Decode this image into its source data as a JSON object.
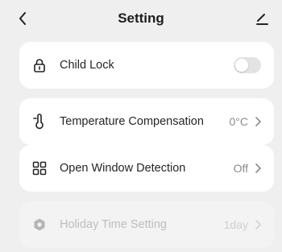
{
  "header": {
    "title": "Setting",
    "back_icon": "chevron-left-icon",
    "edit_icon": "edit-icon"
  },
  "settings": [
    {
      "label": "Child Lock",
      "icon": "lock-icon",
      "control": "toggle",
      "toggle_on": false
    },
    {
      "label": "Temperature Compensation",
      "icon": "thermometer-icon",
      "value": "0°C"
    },
    {
      "label": "Open Window Detection",
      "icon": "grid-icon",
      "value": "Off"
    },
    {
      "label": "Holiday Time Setting",
      "icon": "hexagon-icon",
      "value": "1day",
      "disabled": true
    }
  ],
  "colors": {
    "background": "#efefef",
    "card": "#ffffff",
    "text": "#262626",
    "muted": "#8b8b8b",
    "disabled_text": "#bdbdbd"
  }
}
